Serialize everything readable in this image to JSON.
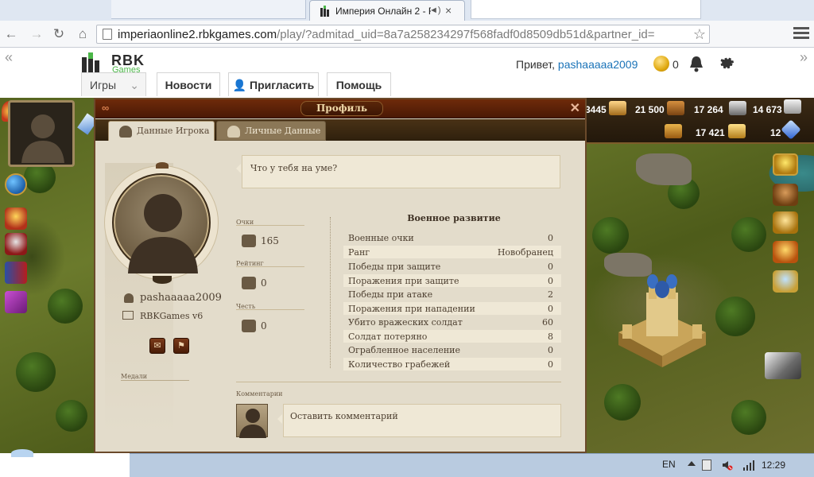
{
  "browser": {
    "active_tab_title": "Империя Онлайн 2 - F",
    "url_host": "imperiaonline2.rbkgames.com",
    "url_path": "/play/?admitad_uid=8a7a258234297f568fadf0d8509db51d&partner_id="
  },
  "site": {
    "logo_text": "RBK",
    "logo_sub": "Games",
    "greeting_prefix": "Привет,",
    "username": "pashaaaaa2009",
    "coins": "0",
    "nav": {
      "games": "Игры",
      "news": "Новости",
      "invite": "Пригласить",
      "help": "Помощь"
    }
  },
  "resources": {
    "gold": "3445",
    "wood": "21 500",
    "iron": "17 264",
    "stone": "14 673",
    "coins": "17 421",
    "gems": "12"
  },
  "profile": {
    "title": "Профиль",
    "tabs": {
      "player_data": "Данные Игрока",
      "personal_data": "Личные Данные"
    },
    "username": "pashaaaaa2009",
    "server": "RBKGames v6",
    "medals_label": "Медали",
    "status_prompt": "Что у тебя на уме?",
    "stats": {
      "points_label": "Очки",
      "points_value": "165",
      "rating_label": "Рейтинг",
      "rating_value": "0",
      "honor_label": "Честь",
      "honor_value": "0"
    },
    "military": {
      "title": "Военное развитие",
      "rows": [
        {
          "name": "Военные очки",
          "value": "0"
        },
        {
          "name": "Ранг",
          "value": "Новобранец"
        },
        {
          "name": "Победы при защите",
          "value": "0"
        },
        {
          "name": "Поражения при защите",
          "value": "0"
        },
        {
          "name": "Победы при атаке",
          "value": "2"
        },
        {
          "name": "Поражения при нападении",
          "value": "0"
        },
        {
          "name": "Убито вражеских солдат",
          "value": "60"
        },
        {
          "name": "Солдат потеряно",
          "value": "8"
        },
        {
          "name": "Ограбленное население",
          "value": "0"
        },
        {
          "name": "Количество грабежей",
          "value": "0"
        }
      ]
    },
    "comments_label": "Комментарии",
    "comment_placeholder": "Оставить комментарий"
  },
  "taskbar": {
    "language": "EN",
    "time": "12:29"
  }
}
